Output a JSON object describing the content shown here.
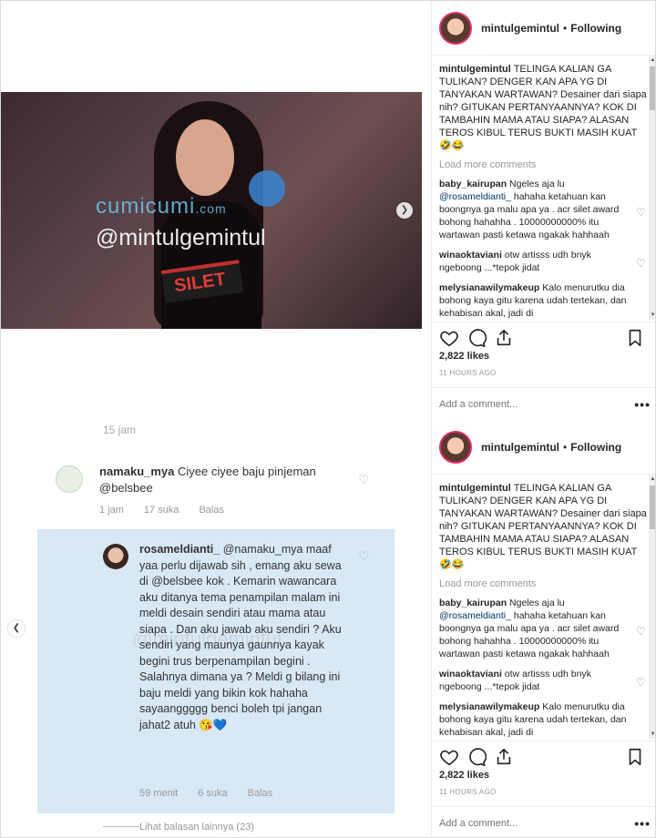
{
  "posts": [
    {
      "username": "mintulgemintul",
      "follow_status": "Following",
      "caption_user": "mintulgemintul",
      "caption_text": "TELINGA KALIAN GA TULIKAN? DENGER KAN APA YG DI TANYAKAN WARTAWAN? Desainer dari siapa nih? GITUKAN PERTANYAANNYA? KOK DI TAMBAHIN MAMA ATAU SIAPA? ALASAN TEROS KIBUL TERUS BUKTI MASIH KUAT 🤣😂",
      "load_more": "Load more comments",
      "comments": [
        {
          "user": "baby_kairupan",
          "pre": "Ngeles aja lu",
          "mention": "@rosameldianti_",
          "text": " hahaha ketahuan kan boongnya ga malu apa ya . acr silet award bohong hahahha . 10000000000% itu wartawan pasti ketawa ngakak hahhaah"
        },
        {
          "user": "winaoktaviani",
          "pre": "",
          "mention": "",
          "text": "otw artisss udh bnyk ngeboong ...*tepok jidat"
        },
        {
          "user": "melysianawilymakeup",
          "pre": "",
          "mention": "",
          "text": "Kalo menurutku dia bohong kaya gitu karena udah tertekan, dan kehabisan akal, jadi di"
        }
      ],
      "likes": "2,822 likes",
      "time": "11 HOURS AGO",
      "add_comment_placeholder": "Add a comment...",
      "more": "•••",
      "media": {
        "watermark_1": "cumicumi",
        "watermark_domain": ".com",
        "watermark_2": "@mintulgemintul",
        "mic_label": "SILET"
      }
    },
    {
      "username": "mintulgemintul",
      "follow_status": "Following",
      "caption_user": "mintulgemintul",
      "caption_text": "TELINGA KALIAN GA TULIKAN? DENGER KAN APA YG DI TANYAKAN WARTAWAN? Desainer dari siapa nih? GITUKAN PERTANYAANNYA? KOK DI TAMBAHIN MAMA ATAU SIAPA? ALASAN TEROS KIBUL TERUS BUKTI MASIH KUAT 🤣😂",
      "load_more": "Load more comments",
      "comments": [
        {
          "user": "baby_kairupan",
          "pre": "Ngeles aja lu",
          "mention": "@rosameldianti_",
          "text": " hahaha ketahuan kan boongnya ga malu apa ya . acr silet award bohong hahahha . 10000000000% itu wartawan pasti ketawa ngakak hahhaah"
        },
        {
          "user": "winaoktaviani",
          "pre": "",
          "mention": "",
          "text": "otw artisss udh bnyk ngeboong ...*tepok jidat"
        },
        {
          "user": "melysianawilymakeup",
          "pre": "",
          "mention": "",
          "text": "Kalo menurutku dia bohong kaya gitu karena udah tertekan, dan kehabisan akal, jadi di"
        }
      ],
      "likes": "2,822 likes",
      "time": "11 HOURS AGO",
      "add_comment_placeholder": "Add a comment...",
      "more": "•••",
      "media": {
        "timestamp": "15 jam",
        "c1_user": "namaku_mya",
        "c1_text": "Ciyee ciyee baju pinjeman",
        "c1_mention": "@belsbee",
        "c1_time": "1 jam",
        "c1_likes": "17 suka",
        "c1_reply": "Balas",
        "c2_user": "rosameldianti_",
        "c2_text": "@namaku_mya maaf yaa perlu dijawab sih , emang aku sewa di @belsbee kok . Kemarin wawancara aku ditanya tema penampilan malam ini meldi desain sendiri atau mama atau siapa . Dan aku jawab aku sendiri ? Aku sendiri yang maunya gaunnya kayak begini trus berpenampilan begini . Salahnya dimana ya ? Meldi g bilang ini baju meldi yang bikin kok hahaha sayaanggggg benci boleh tpi jangan jahat2 atuh 😘💙",
        "c2_time": "59 menit",
        "c2_likes": "6 suka",
        "c2_reply": "Balas",
        "watermark": "@mintulgemintul",
        "view_more": "Lihat balasan lainnya (23)"
      }
    }
  ],
  "icons": {
    "heart": "heart-icon",
    "comment": "comment-icon",
    "share": "share-icon",
    "bookmark": "bookmark-icon"
  }
}
